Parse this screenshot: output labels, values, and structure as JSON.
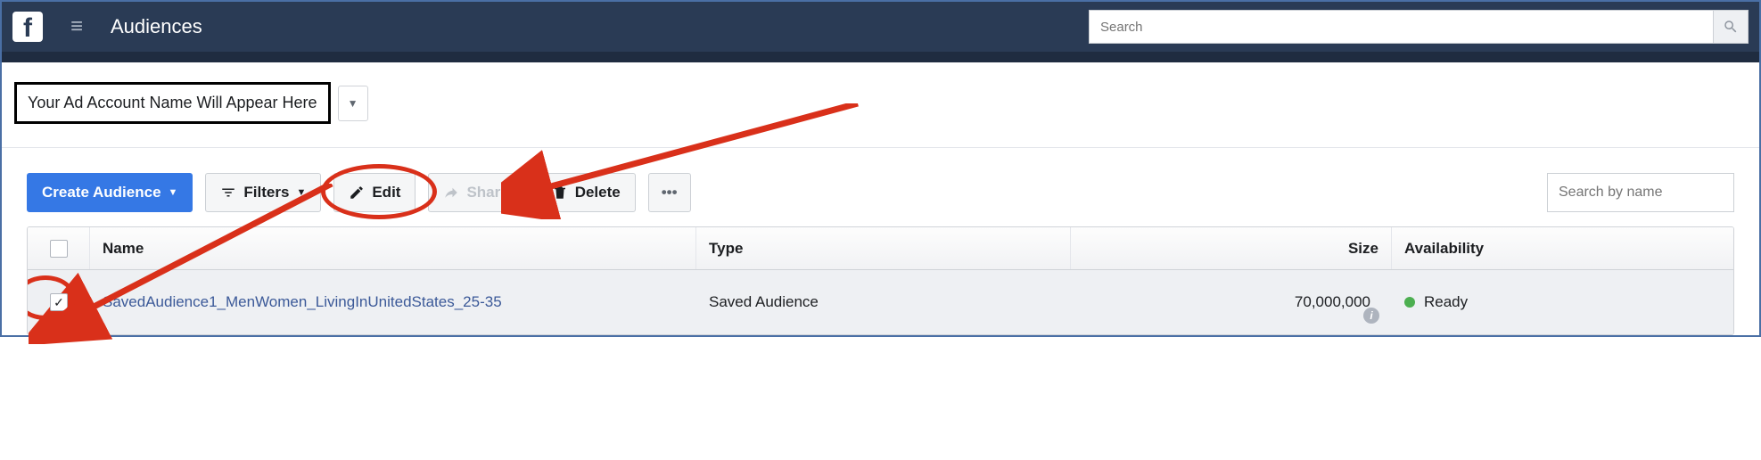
{
  "nav": {
    "page_title": "Audiences",
    "search_placeholder": "Search"
  },
  "account": {
    "placeholder_text": "Your Ad Account Name Will Appear Here"
  },
  "toolbar": {
    "create_label": "Create Audience",
    "filters_label": "Filters",
    "edit_label": "Edit",
    "share_label": "Share",
    "delete_label": "Delete",
    "name_search_placeholder": "Search by name"
  },
  "columns": {
    "name": "Name",
    "type": "Type",
    "size": "Size",
    "availability": "Availability"
  },
  "rows": [
    {
      "checked": true,
      "name": "SavedAudience1_MenWomen_LivingInUnitedStates_25-35",
      "type": "Saved Audience",
      "size": "70,000,000",
      "availability": "Ready"
    }
  ]
}
